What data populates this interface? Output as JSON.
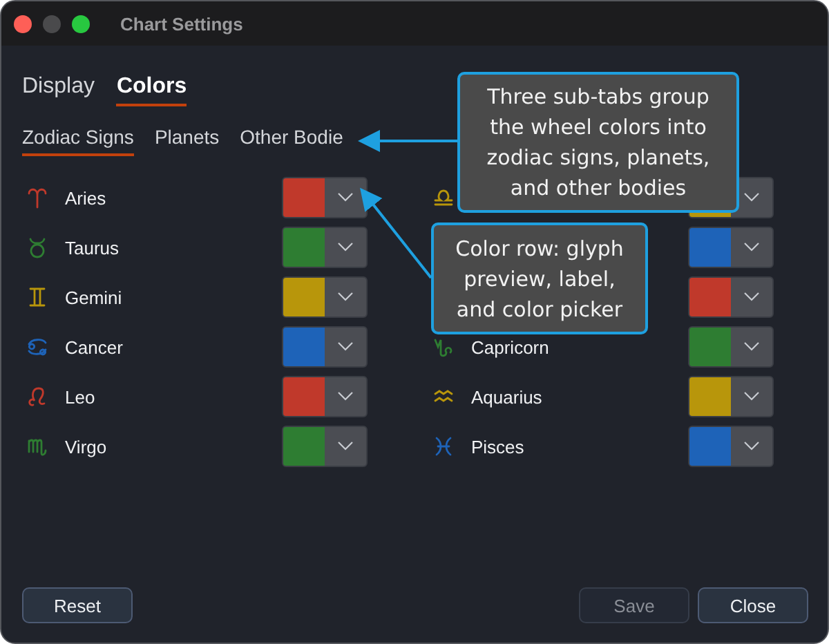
{
  "window": {
    "title": "Chart Settings"
  },
  "tabs": [
    {
      "label": "Display",
      "selected": false
    },
    {
      "label": "Colors",
      "selected": true
    }
  ],
  "sub_tabs": [
    {
      "label": "Zodiac Signs",
      "selected": true
    },
    {
      "label": "Planets",
      "selected": false
    },
    {
      "label": "Other Bodie",
      "selected": false
    }
  ],
  "color_rows_left": [
    {
      "label": "Aries",
      "color": "#c0392b"
    },
    {
      "label": "Taurus",
      "color": "#2e7d32"
    },
    {
      "label": "Gemini",
      "color": "#b8960b"
    },
    {
      "label": "Cancer",
      "color": "#1e63b8"
    },
    {
      "label": "Leo",
      "color": "#c0392b"
    },
    {
      "label": "Virgo",
      "color": "#2e7d32"
    }
  ],
  "color_rows_right": [
    {
      "color": "#b8960b"
    },
    {
      "color": "#1e63b8"
    },
    {
      "color": "#c0392b"
    },
    {
      "label": "Capricorn",
      "color": "#2e7d32"
    },
    {
      "label": "Aquarius",
      "color": "#b8960b"
    },
    {
      "label": "Pisces",
      "color": "#1e63b8"
    }
  ],
  "buttons": [
    {
      "label": "Reset",
      "disabled": false
    },
    {
      "label": "Save",
      "disabled": true
    },
    {
      "label": "Close",
      "disabled": false
    }
  ],
  "annotations": [
    "Three sub-tabs group the wheel colors into zodiac signs, planets, and other bodies",
    "Color row: glyph preview, label, and color picker"
  ]
}
